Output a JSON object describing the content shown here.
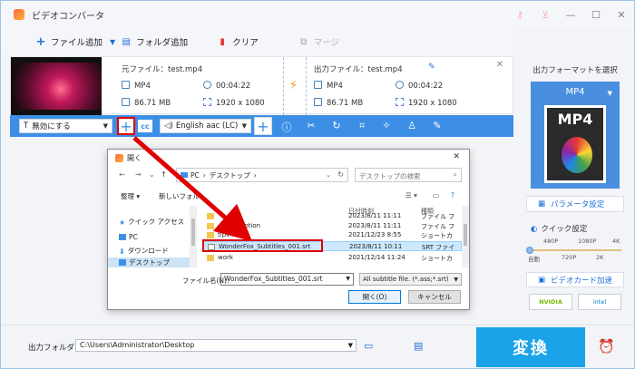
{
  "window": {
    "title": "ビデオコンバータ",
    "icons": [
      "key-icon",
      "cart-icon",
      "minimize-icon",
      "maximize-icon",
      "close-icon"
    ]
  },
  "toolbar": {
    "add_file": "ファイル追加",
    "add_folder": "フォルダ追加",
    "clear": "クリア",
    "merge": "マージ"
  },
  "file": {
    "source_label": "元ファイル：test.mp4",
    "source_format": "MP4",
    "source_duration": "00:04:22",
    "source_size": "86.71 MB",
    "source_resolution": "1920 x 1080",
    "output_label": "出力ファイル：test.mp4",
    "output_format": "MP4",
    "output_duration": "00:04:22",
    "output_size": "86.71 MB",
    "output_resolution": "1920 x 1080"
  },
  "editbar": {
    "subtitle_select": "無効にする",
    "audio_select": "English aac (LC)",
    "tools": [
      "info-icon",
      "scissors-icon",
      "rotate-icon",
      "crop-icon",
      "effects-icon",
      "watermark-icon",
      "edit-icon"
    ]
  },
  "right_panel": {
    "title": "出力フォーマットを選択",
    "format": "MP4",
    "format_art_label": "MP4",
    "param_button": "パラメータ設定",
    "quick_label": "クイック設定",
    "quality_top": [
      "480P",
      "1080P",
      "4K"
    ],
    "quality_bottom": [
      "自動",
      "720P",
      "2K"
    ],
    "quality_level": 0,
    "gpu_button": "ビデオカード加速",
    "gpu_badges": [
      "NVIDIA",
      "intel"
    ]
  },
  "bottom": {
    "output_folder_label": "出力フォルダ：",
    "output_path": "C:\\Users\\Administrator\\Desktop",
    "convert": "変換"
  },
  "dialog": {
    "title": "開く",
    "address_pc": "PC",
    "address_sep": "›",
    "address_folder": "デスクトップ",
    "search_placeholder": "デスクトップの検索",
    "organize": "整理 ▾",
    "new_folder": "新しいフォルダー",
    "tree": [
      "クイック アクセス",
      "PC",
      "ダウンロード",
      "デスクトップ"
    ],
    "col_date": "日付時刻",
    "col_type": "種類",
    "files": [
      {
        "name": "",
        "date": "2023/8/11 11:11",
        "type": "ファイル フ"
      },
      {
        "name": "-transcription",
        "date": "2023/8/11 11:11",
        "type": "ファイル フ"
      },
      {
        "name": "tips",
        "date": "2021/12/23 8:55",
        "type": "ショートカ"
      },
      {
        "name": "WonderFox_Subtitles_001.srt",
        "date": "2023/8/11 10:11",
        "type": "SRT ファイ"
      },
      {
        "name": "work",
        "date": "2021/12/14 11:24",
        "type": "ショートカ"
      }
    ],
    "filename_label": "ファイル名(N):",
    "filename_value": "WonderFox_Subtitles_001.srt",
    "filter": "All subtitle file. (*.ass;*.srt)",
    "open": "開く(O)",
    "cancel": "キャンセル"
  }
}
